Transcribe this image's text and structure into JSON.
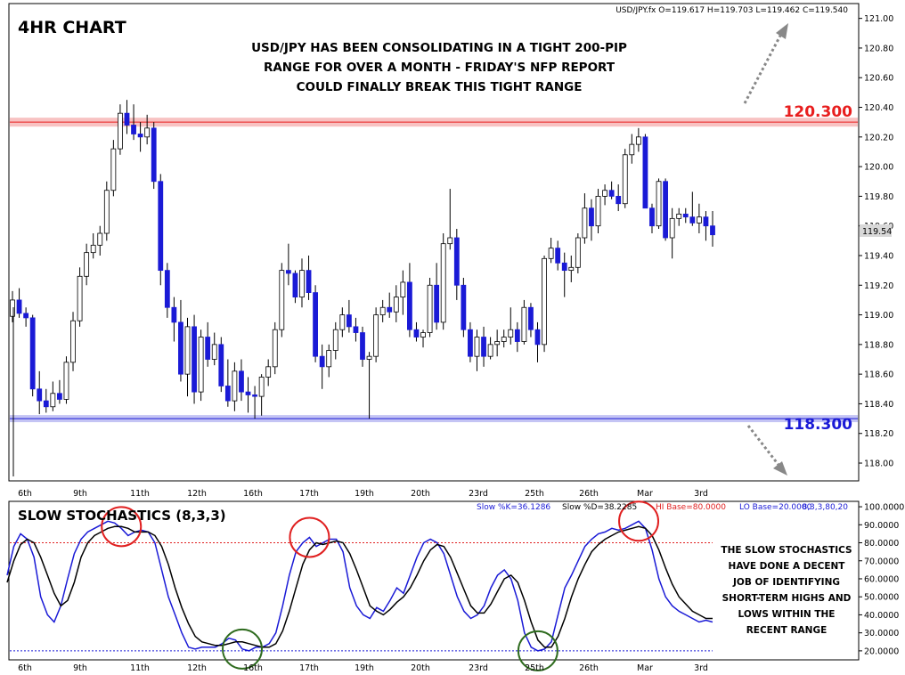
{
  "chart_data": [
    {
      "type": "candlestick",
      "title": "4HR CHART",
      "symbol_info": "USD/JPY.fx O=119.617 H=119.703 L=119.462 C=119.540",
      "annotation": [
        "USD/JPY HAS BEEN CONSOLIDATING IN A TIGHT 200-PIP",
        "RANGE FOR OVER A MONTH - FRIDAY'S NFP REPORT",
        "COULD FINALLY BREAK THIS TIGHT RANGE"
      ],
      "ylim": [
        117.88,
        121.1
      ],
      "y_ticks": [
        "121.00",
        "120.80",
        "120.60",
        "120.40",
        "120.20",
        "120.00",
        "119.80",
        "119.60",
        "119.40",
        "119.20",
        "119.00",
        "118.80",
        "118.60",
        "118.40",
        "118.20",
        "118.00"
      ],
      "x_labels": [
        "6th",
        "9th",
        "11th",
        "12th",
        "16th",
        "17th",
        "19th",
        "20th",
        "23rd",
        "25th",
        "26th",
        "Mar",
        "3rd"
      ],
      "current_price": "119.54",
      "resistance": {
        "value": 120.3,
        "label": "120.300",
        "color": "#e81e1e"
      },
      "support": {
        "value": 118.3,
        "label": "118.300",
        "color": "#1a1ad6"
      },
      "colors": {
        "bull": "#ffffff",
        "bear": "#1a1ad6",
        "wick": "#000000"
      },
      "candles": [
        [
          118.99,
          119.16,
          118.95,
          119.1
        ],
        [
          119.1,
          119.18,
          118.98,
          119.01
        ],
        [
          119.01,
          119.05,
          118.92,
          118.98
        ],
        [
          118.98,
          119.0,
          118.45,
          118.5
        ],
        [
          118.5,
          118.62,
          118.33,
          118.42
        ],
        [
          118.42,
          118.5,
          118.34,
          118.38
        ],
        [
          118.38,
          118.55,
          118.35,
          118.47
        ],
        [
          118.47,
          118.56,
          118.4,
          118.43
        ],
        [
          118.43,
          118.72,
          118.4,
          118.68
        ],
        [
          118.68,
          119.02,
          118.62,
          118.96
        ],
        [
          118.96,
          119.32,
          118.92,
          119.26
        ],
        [
          119.26,
          119.48,
          119.2,
          119.42
        ],
        [
          119.42,
          119.55,
          119.38,
          119.47
        ],
        [
          119.47,
          119.6,
          119.4,
          119.55
        ],
        [
          119.55,
          119.9,
          119.5,
          119.84
        ],
        [
          119.84,
          120.18,
          119.8,
          120.12
        ],
        [
          120.12,
          120.42,
          120.08,
          120.36
        ],
        [
          120.36,
          120.45,
          120.22,
          120.28
        ],
        [
          120.28,
          120.42,
          120.18,
          120.22
        ],
        [
          120.22,
          120.3,
          120.1,
          120.2
        ],
        [
          120.2,
          120.35,
          120.15,
          120.26
        ],
        [
          120.26,
          120.3,
          119.85,
          119.9
        ],
        [
          119.9,
          119.95,
          119.2,
          119.3
        ],
        [
          119.3,
          119.35,
          118.98,
          119.05
        ],
        [
          119.05,
          119.12,
          118.82,
          118.95
        ],
        [
          118.95,
          119.1,
          118.55,
          118.6
        ],
        [
          118.6,
          118.98,
          118.45,
          118.92
        ],
        [
          118.92,
          119.0,
          118.4,
          118.48
        ],
        [
          118.48,
          118.9,
          118.42,
          118.85
        ],
        [
          118.85,
          118.95,
          118.65,
          118.7
        ],
        [
          118.7,
          118.88,
          118.66,
          118.8
        ],
        [
          118.8,
          118.85,
          118.48,
          118.52
        ],
        [
          118.52,
          118.7,
          118.38,
          118.42
        ],
        [
          118.42,
          118.68,
          118.35,
          118.62
        ],
        [
          118.62,
          118.7,
          118.42,
          118.48
        ],
        [
          118.48,
          118.58,
          118.34,
          118.46
        ],
        [
          118.46,
          118.52,
          118.3,
          118.45
        ],
        [
          118.45,
          118.6,
          118.32,
          118.58
        ],
        [
          118.58,
          118.7,
          118.52,
          118.65
        ],
        [
          118.65,
          118.95,
          118.6,
          118.9
        ],
        [
          118.9,
          119.35,
          118.85,
          119.3
        ],
        [
          119.3,
          119.48,
          119.2,
          119.28
        ],
        [
          119.28,
          119.3,
          119.08,
          119.12
        ],
        [
          119.12,
          119.38,
          119.05,
          119.3
        ],
        [
          119.3,
          119.4,
          119.1,
          119.15
        ],
        [
          119.15,
          119.2,
          118.68,
          118.72
        ],
        [
          118.72,
          118.8,
          118.5,
          118.65
        ],
        [
          118.65,
          118.8,
          118.58,
          118.76
        ],
        [
          118.76,
          118.95,
          118.7,
          118.9
        ],
        [
          118.9,
          119.05,
          118.85,
          119.0
        ],
        [
          119.0,
          119.1,
          118.88,
          118.92
        ],
        [
          118.92,
          118.98,
          118.82,
          118.88
        ],
        [
          118.88,
          118.92,
          118.65,
          118.7
        ],
        [
          118.7,
          118.75,
          118.3,
          118.72
        ],
        [
          118.72,
          119.05,
          118.68,
          119.0
        ],
        [
          119.0,
          119.1,
          118.95,
          119.05
        ],
        [
          119.05,
          119.15,
          118.98,
          119.02
        ],
        [
          119.02,
          119.2,
          118.95,
          119.12
        ],
        [
          119.12,
          119.3,
          119.0,
          119.22
        ],
        [
          119.22,
          119.35,
          118.85,
          118.9
        ],
        [
          118.9,
          118.95,
          118.82,
          118.85
        ],
        [
          118.85,
          118.9,
          118.78,
          118.88
        ],
        [
          118.88,
          119.25,
          118.85,
          119.2
        ],
        [
          119.2,
          119.35,
          118.9,
          118.95
        ],
        [
          118.95,
          119.55,
          118.9,
          119.48
        ],
        [
          119.48,
          119.85,
          119.44,
          119.52
        ],
        [
          119.52,
          119.58,
          119.1,
          119.2
        ],
        [
          119.2,
          119.25,
          118.85,
          118.9
        ],
        [
          118.9,
          118.95,
          118.68,
          118.72
        ],
        [
          118.72,
          118.9,
          118.62,
          118.85
        ],
        [
          118.85,
          118.92,
          118.65,
          118.72
        ],
        [
          118.72,
          118.85,
          118.7,
          118.8
        ],
        [
          118.8,
          118.9,
          118.72,
          118.82
        ],
        [
          118.82,
          118.9,
          118.78,
          118.85
        ],
        [
          118.85,
          119.05,
          118.8,
          118.9
        ],
        [
          118.9,
          118.95,
          118.75,
          118.82
        ],
        [
          118.82,
          119.1,
          118.8,
          119.05
        ],
        [
          119.05,
          119.08,
          118.85,
          118.9
        ],
        [
          118.9,
          118.95,
          118.68,
          118.8
        ],
        [
          118.8,
          119.4,
          118.75,
          119.38
        ],
        [
          119.38,
          119.52,
          119.35,
          119.45
        ],
        [
          119.45,
          119.5,
          119.3,
          119.35
        ],
        [
          119.35,
          119.42,
          119.12,
          119.3
        ],
        [
          119.3,
          119.4,
          119.22,
          119.32
        ],
        [
          119.32,
          119.55,
          119.28,
          119.52
        ],
        [
          119.52,
          119.82,
          119.48,
          119.72
        ],
        [
          119.72,
          119.78,
          119.5,
          119.6
        ],
        [
          119.6,
          119.85,
          119.55,
          119.8
        ],
        [
          119.8,
          119.88,
          119.74,
          119.84
        ],
        [
          119.84,
          119.9,
          119.78,
          119.8
        ],
        [
          119.8,
          119.88,
          119.7,
          119.75
        ],
        [
          119.75,
          120.12,
          119.72,
          120.08
        ],
        [
          120.08,
          120.22,
          120.02,
          120.15
        ],
        [
          120.15,
          120.26,
          120.1,
          120.2
        ],
        [
          120.2,
          120.22,
          119.75,
          119.72
        ],
        [
          119.72,
          119.75,
          119.55,
          119.6
        ],
        [
          119.6,
          119.92,
          119.58,
          119.9
        ],
        [
          119.9,
          119.92,
          119.5,
          119.52
        ],
        [
          119.52,
          119.72,
          119.38,
          119.65
        ],
        [
          119.65,
          119.72,
          119.6,
          119.68
        ],
        [
          119.68,
          119.72,
          119.62,
          119.66
        ],
        [
          119.66,
          119.83,
          119.6,
          119.62
        ],
        [
          119.62,
          119.75,
          119.55,
          119.66
        ],
        [
          119.66,
          119.7,
          119.5,
          119.6
        ],
        [
          119.6,
          119.7,
          119.46,
          119.54
        ]
      ]
    },
    {
      "type": "line",
      "title": "SLOW STOCHASTICS (8,3,3)",
      "info_k": "Slow %K=36.1286",
      "info_d": "Slow %D=38.2285",
      "info_hi": "HI Base=80.0000",
      "info_lo": "LO Base=20.0000",
      "info_params": "8,3,3,80,20",
      "ylim": [
        15,
        103
      ],
      "y_ticks": [
        "100.0000",
        "90.0000",
        "80.0000",
        "70.0000",
        "60.0000",
        "50.0000",
        "40.0000",
        "30.0000",
        "20.0000"
      ],
      "x_labels": [
        "6th",
        "9th",
        "11th",
        "12th",
        "16th",
        "17th",
        "19th",
        "20th",
        "23rd",
        "25th",
        "26th",
        "Mar",
        "3rd"
      ],
      "hi_base": 80,
      "lo_base": 20,
      "annotation": [
        "THE SLOW STOCHASTICS",
        "HAVE DONE A DECENT",
        "JOB OF IDENTIFYING",
        "SHORT-TERM HIGHS AND",
        "LOWS WITHIN THE",
        "RECENT RANGE"
      ],
      "colors": {
        "k": "#1a1ad6",
        "d": "#000000",
        "circle_high": "#e02020",
        "circle_low": "#2e6b1e"
      },
      "series": [
        {
          "name": "Slow %K",
          "values": [
            62,
            78,
            85,
            82,
            72,
            50,
            40,
            36,
            45,
            60,
            74,
            82,
            86,
            88,
            90,
            92,
            91,
            88,
            84,
            86,
            87,
            86,
            80,
            65,
            50,
            40,
            30,
            22,
            21,
            22,
            22,
            22,
            24,
            27,
            26,
            21,
            20,
            22,
            22,
            24,
            30,
            45,
            62,
            75,
            80,
            83,
            78,
            80,
            82,
            82,
            75,
            55,
            45,
            40,
            38,
            44,
            42,
            48,
            55,
            52,
            62,
            72,
            80,
            82,
            80,
            74,
            62,
            50,
            42,
            38,
            40,
            45,
            55,
            62,
            65,
            60,
            48,
            30,
            22,
            20,
            21,
            25,
            40,
            55,
            62,
            70,
            78,
            82,
            85,
            86,
            88,
            87,
            88,
            90,
            92,
            88,
            76,
            60,
            50,
            45,
            42,
            40,
            38,
            36,
            37,
            36
          ]
        },
        {
          "name": "Slow %D",
          "values": [
            58,
            70,
            79,
            82,
            80,
            72,
            62,
            52,
            45,
            48,
            58,
            72,
            80,
            84,
            86,
            88,
            89,
            89,
            88,
            86,
            86,
            86,
            84,
            78,
            68,
            55,
            44,
            35,
            28,
            25,
            24,
            23,
            23,
            24,
            25,
            25,
            24,
            23,
            22,
            22,
            24,
            31,
            42,
            55,
            68,
            76,
            80,
            79,
            80,
            81,
            80,
            74,
            65,
            55,
            45,
            42,
            40,
            43,
            47,
            50,
            55,
            62,
            70,
            76,
            79,
            78,
            72,
            63,
            54,
            45,
            41,
            41,
            46,
            53,
            60,
            62,
            58,
            48,
            36,
            26,
            22,
            22,
            28,
            38,
            50,
            60,
            68,
            75,
            79,
            82,
            84,
            86,
            87,
            88,
            89,
            88,
            84,
            76,
            66,
            57,
            50,
            46,
            42,
            40,
            38,
            38
          ]
        }
      ],
      "highlights_high": [
        17,
        45,
        94
      ],
      "highlights_low": [
        35,
        79
      ]
    }
  ]
}
